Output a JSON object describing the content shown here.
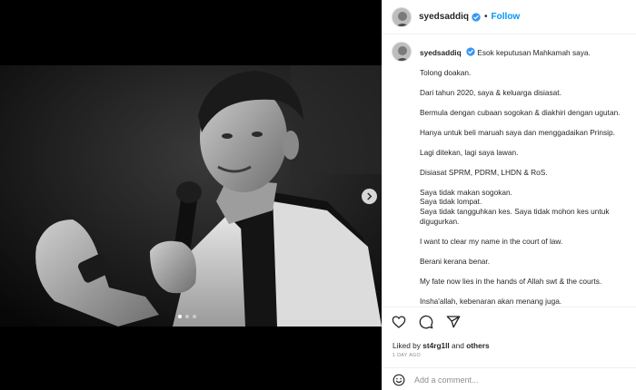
{
  "post": {
    "username": "syedsaddiq",
    "follow_label": "Follow",
    "separator": "•",
    "caption_first_line": "Esok keputusan Mahkamah saya.",
    "caption_paragraphs": [
      "Tolong doakan.",
      "Dari tahun 2020, saya & keluarga disiasat.",
      "Bermula dengan cubaan sogokan & diakhiri dengan ugutan.",
      "Hanya untuk beli maruah saya dan menggadaikan Prinsip.",
      "Lagi ditekan, lagi saya lawan.",
      "Disiasat SPRM, PDRM, LHDN & RoS.",
      "Saya tidak makan sogokan.\nSaya tidak lompat.\nSaya tidak tangguhkan kes. Saya tidak mohon kes untuk digugurkan.",
      "I want to clear my name in the court of law.",
      "Berani kerana benar.",
      "My fate now lies in the hands of Allah swt & the courts.",
      "Insha'allah, kebenaran akan menang juga."
    ],
    "liked_by_prefix": "Liked by ",
    "liked_by_user": "st4rg1ll",
    "liked_by_and": " and ",
    "liked_by_others": "others",
    "time_ago": "1 DAY AGO",
    "comment_placeholder": "Add a comment..."
  },
  "carousel": {
    "total_slides": 3,
    "active_slide": 1
  },
  "icons": {
    "verified": "verified-badge-icon",
    "like": "heart-icon",
    "comment": "comment-bubble-icon",
    "share": "paper-plane-icon",
    "emoji": "smiley-icon",
    "next": "chevron-right-icon"
  },
  "colors": {
    "link_blue": "#0095f6",
    "verified_blue": "#3897f0",
    "muted": "#8e8e8e"
  }
}
